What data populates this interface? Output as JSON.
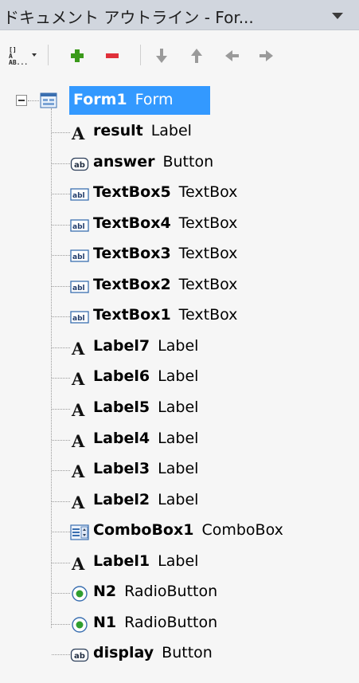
{
  "header": {
    "title": "ドキュメント アウトライン - For..."
  },
  "toolbar": {
    "sort_label": "[] A AB..."
  },
  "tree": {
    "root": {
      "name": "Form1",
      "type": "Form"
    },
    "items": [
      {
        "name": "result",
        "type": "Label",
        "icon": "label-icon"
      },
      {
        "name": "answer",
        "type": "Button",
        "icon": "button-icon"
      },
      {
        "name": "TextBox5",
        "type": "TextBox",
        "icon": "textbox-icon"
      },
      {
        "name": "TextBox4",
        "type": "TextBox",
        "icon": "textbox-icon"
      },
      {
        "name": "TextBox3",
        "type": "TextBox",
        "icon": "textbox-icon"
      },
      {
        "name": "TextBox2",
        "type": "TextBox",
        "icon": "textbox-icon"
      },
      {
        "name": "TextBox1",
        "type": "TextBox",
        "icon": "textbox-icon"
      },
      {
        "name": "Label7",
        "type": "Label",
        "icon": "label-icon"
      },
      {
        "name": "Label6",
        "type": "Label",
        "icon": "label-icon"
      },
      {
        "name": "Label5",
        "type": "Label",
        "icon": "label-icon"
      },
      {
        "name": "Label4",
        "type": "Label",
        "icon": "label-icon"
      },
      {
        "name": "Label3",
        "type": "Label",
        "icon": "label-icon"
      },
      {
        "name": "Label2",
        "type": "Label",
        "icon": "label-icon"
      },
      {
        "name": "ComboBox1",
        "type": "ComboBox",
        "icon": "combobox-icon"
      },
      {
        "name": "Label1",
        "type": "Label",
        "icon": "label-icon"
      },
      {
        "name": "N2",
        "type": "RadioButton",
        "icon": "radiobutton-icon"
      },
      {
        "name": "N1",
        "type": "RadioButton",
        "icon": "radiobutton-icon"
      },
      {
        "name": "display",
        "type": "Button",
        "icon": "button-icon"
      }
    ]
  },
  "colors": {
    "selection": "#3399ff",
    "titlebar": "#d1d6de",
    "add": "#3a9a1a",
    "remove": "#e0303a"
  }
}
